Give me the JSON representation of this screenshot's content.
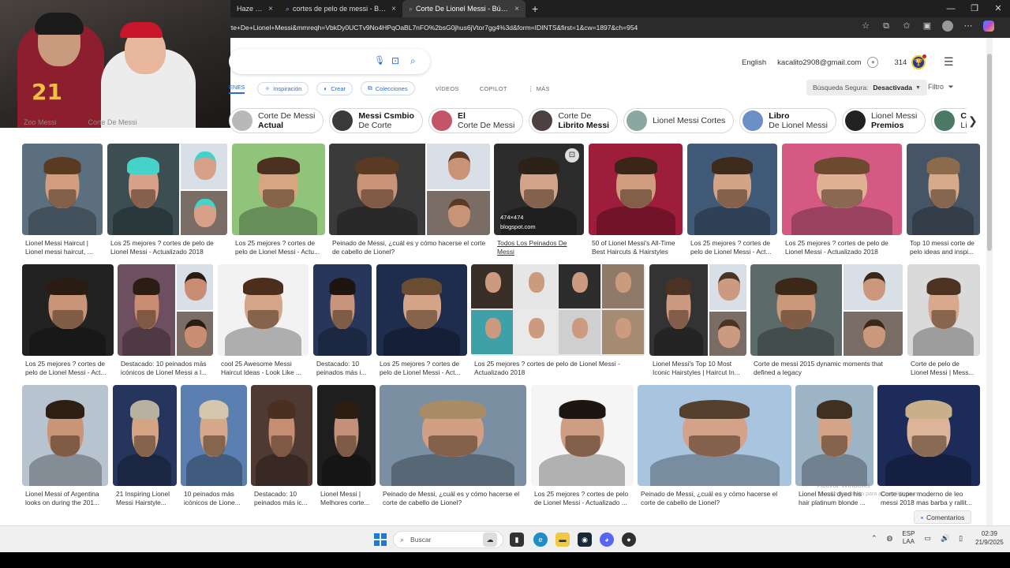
{
  "browser": {
    "tabs": [
      {
        "title": "Haze - Amar",
        "close": "×"
      },
      {
        "title": "cortes de pelo de messi - Búsqued",
        "close": "×"
      },
      {
        "title": "Corte De Lionel Messi - Búsqueda",
        "close": "×",
        "active": true
      }
    ],
    "new_tab": "+",
    "window_controls": [
      "—",
      "❐",
      "✕"
    ],
    "url": "rte+De+Lionel+Messi&mmreqh=VbkDy0UCTv9No4HPqOaBL7nFO%2bsG0jhus6jVtor7gg4%3d&form=IDINTS&first=1&cw=1897&ch=954"
  },
  "header": {
    "language": "English",
    "email": "kacalito2908@gmail.com",
    "points": "314"
  },
  "nav": {
    "active_partial": "ENES",
    "inspiration": "Inspiración",
    "create": "Crear",
    "collections": "Colecciones",
    "videos": "VÍDEOS",
    "copilot": "COPILOT",
    "more": "MÁS",
    "safe_search_label": "Búsqueda Segura:",
    "safe_search_value": "Desactivada",
    "filter": "Filtro"
  },
  "chips_ghost": [
    "Zoo Messi",
    "Corte De Messi"
  ],
  "chips": [
    {
      "line1": "Corte De Messi",
      "line2": "Actual",
      "bold": "line2",
      "thumb": "#b8b8b8"
    },
    {
      "line1": "Messi Csmbio",
      "line2": "De Corte",
      "bold": "line1",
      "thumb": "#3a3a3a"
    },
    {
      "line1": "El",
      "line2": "Corte De Messi",
      "bold": "line1",
      "thumb": "#c25668"
    },
    {
      "line1": "Corte De",
      "line2": "Librito Messi",
      "bold": "line2",
      "thumb": "#4d4040"
    },
    {
      "line1": "Lionel Messi Cortes",
      "line2": "",
      "bold": "none",
      "thumb": "#8aa7a0"
    },
    {
      "line1": "Libro",
      "line2": "De Lionel Messi",
      "bold": "line1",
      "thumb": "#6d8fc7"
    },
    {
      "line1": "Lionel Messi",
      "line2": "Premios",
      "bold": "line2",
      "thumb": "#222222"
    },
    {
      "line1": "Corte Cabello",
      "line2": "Lionel Messi",
      "bold": "line1",
      "thumb": "#4a7a66"
    }
  ],
  "results": [
    {
      "caption": "Lionel Messi Haircut | Lionel messi haircut, ..."
    },
    {
      "caption": "Los 25 mejores ? cortes de pelo de Lionel Messi - Actualizado 2018"
    },
    {
      "caption": "Los 25 mejores ? cortes de pelo de Lionel Messi - Actu..."
    },
    {
      "caption": "Peinado de Messi, ¿cuál es y cómo hacerse el corte de cabello de Lionel?"
    },
    {
      "caption": "Todos Los Peinados De Messi",
      "hover_size": "474×474",
      "hover_source": "blogspot.com"
    },
    {
      "caption": "50 of Lionel Messi's All-Time Best Haircuts & Hairstyles"
    },
    {
      "caption": "Los 25 mejores ? cortes de pelo de Lionel Messi - Act..."
    },
    {
      "caption": "Los 25 mejores ? cortes de pelo de Lionel Messi - Actualizado 2018"
    },
    {
      "caption": "Top 10 messi corte de pelo ideas and inspi..."
    },
    {
      "caption": "Los 25 mejores ? cortes de pelo de Lionel Messi - Act..."
    },
    {
      "caption": "Destacado: 10 peinados más icónicos de Lionel Messi a l..."
    },
    {
      "caption": "cool 25 Awesome Messi Haircut Ideas - Look Like ..."
    },
    {
      "caption": "Destacado: 10 peinados más i..."
    },
    {
      "caption": "Los 25 mejores ? cortes de pelo de Lionel Messi - Act..."
    },
    {
      "caption": "Los 25 mejores ? cortes de pelo de Lionel Messi - Actualizado 2018"
    },
    {
      "caption": "Lionel Messi's Top 10 Most Iconic Hairstyles | Haircut In..."
    },
    {
      "caption": "Corte de messi 2015 dynamic moments that defined a legacy"
    },
    {
      "caption": "Corte de pelo de Lionel Messi | Mess..."
    },
    {
      "caption": "Lionel Messi of Argentina looks on during the 201..."
    },
    {
      "caption": "21 Inspiring Lionel Messi Hairstyle..."
    },
    {
      "caption": "10 peinados más icónicos de Lione..."
    },
    {
      "caption": "Destacado: 10 peinados más ic..."
    },
    {
      "caption": "Lionel Messi | Melhores corte..."
    },
    {
      "caption": "Peinado de Messi, ¿cuál es y cómo hacerse el corte de cabello de Lionel?"
    },
    {
      "caption": "Los 25 mejores ? cortes de pelo de Lionel Messi - Actualizado ..."
    },
    {
      "caption": "Peinado de Messi, ¿cuál es y cómo hacerse el corte de cabello de Lionel?"
    },
    {
      "caption": "Lionel Messi dyed his hair platinum blonde ..."
    },
    {
      "caption": "Corte super moderno de leo messi 2018 mas barba y rallit..."
    }
  ],
  "watermark": {
    "line1": "Activar Windows",
    "line2": "Ve a Configuración para activar Windows."
  },
  "comments_button": "Comentarios",
  "taskbar": {
    "search": "Buscar",
    "lang_1": "ESP",
    "lang_2": "LAA",
    "time": "02:39",
    "date": "21/9/2025"
  },
  "colors": {
    "accent": "#2e6cd1",
    "barca_blue": "#1d3f8f",
    "barca_red": "#a5163a"
  }
}
